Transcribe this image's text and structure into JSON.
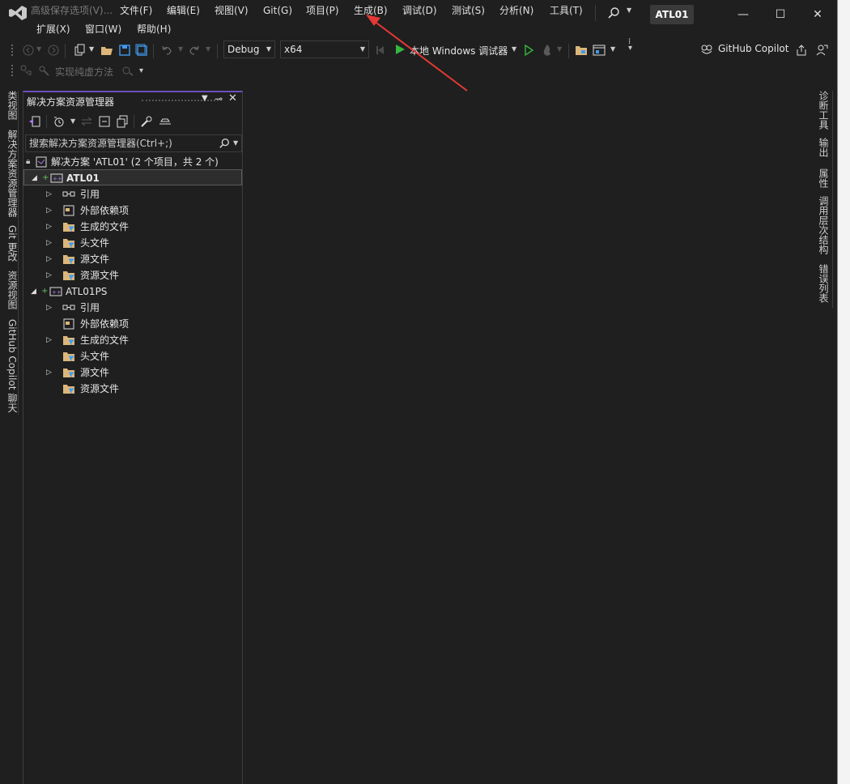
{
  "titlebar": {
    "search_menu": "高级保存选项(V)...",
    "menu": [
      "文件(F)",
      "编辑(E)",
      "视图(V)",
      "Git(G)",
      "项目(P)",
      "生成(B)",
      "调试(D)",
      "测试(S)",
      "分析(N)",
      "工具(T)"
    ],
    "menu2": [
      "扩展(X)",
      "窗口(W)",
      "帮助(H)"
    ],
    "project_badge": "ATL01"
  },
  "toolbar": {
    "config": "Debug",
    "platform": "x64",
    "run_label": "本地 Windows 调试器",
    "copilot": "GitHub Copilot",
    "implement_pure_virtual": "实现纯虚方法"
  },
  "left_tabs": [
    "类视图",
    "解决方案资源管理器",
    "Git 更改",
    "资源视图",
    "GitHub Copilot 聊天"
  ],
  "right_tabs": [
    "诊断工具",
    "输出",
    "属性",
    "调用层次结构",
    "错误列表"
  ],
  "solution_explorer": {
    "title": "解决方案资源管理器",
    "search_placeholder": "搜索解决方案资源管理器(Ctrl+;)",
    "solution": "解决方案 'ATL01' (2 个项目，共 2 个)",
    "projects": [
      {
        "name": "ATL01",
        "children": [
          "引用",
          "外部依赖项",
          "生成的文件",
          "头文件",
          "源文件",
          "资源文件"
        ]
      },
      {
        "name": "ATL01PS",
        "children": [
          "引用",
          "外部依赖项",
          "生成的文件",
          "头文件",
          "源文件",
          "资源文件"
        ]
      }
    ]
  },
  "colors": {
    "background": "#1f1f1f",
    "accent_purple": "#6b4fbb",
    "annotation_red": "#e53935"
  }
}
